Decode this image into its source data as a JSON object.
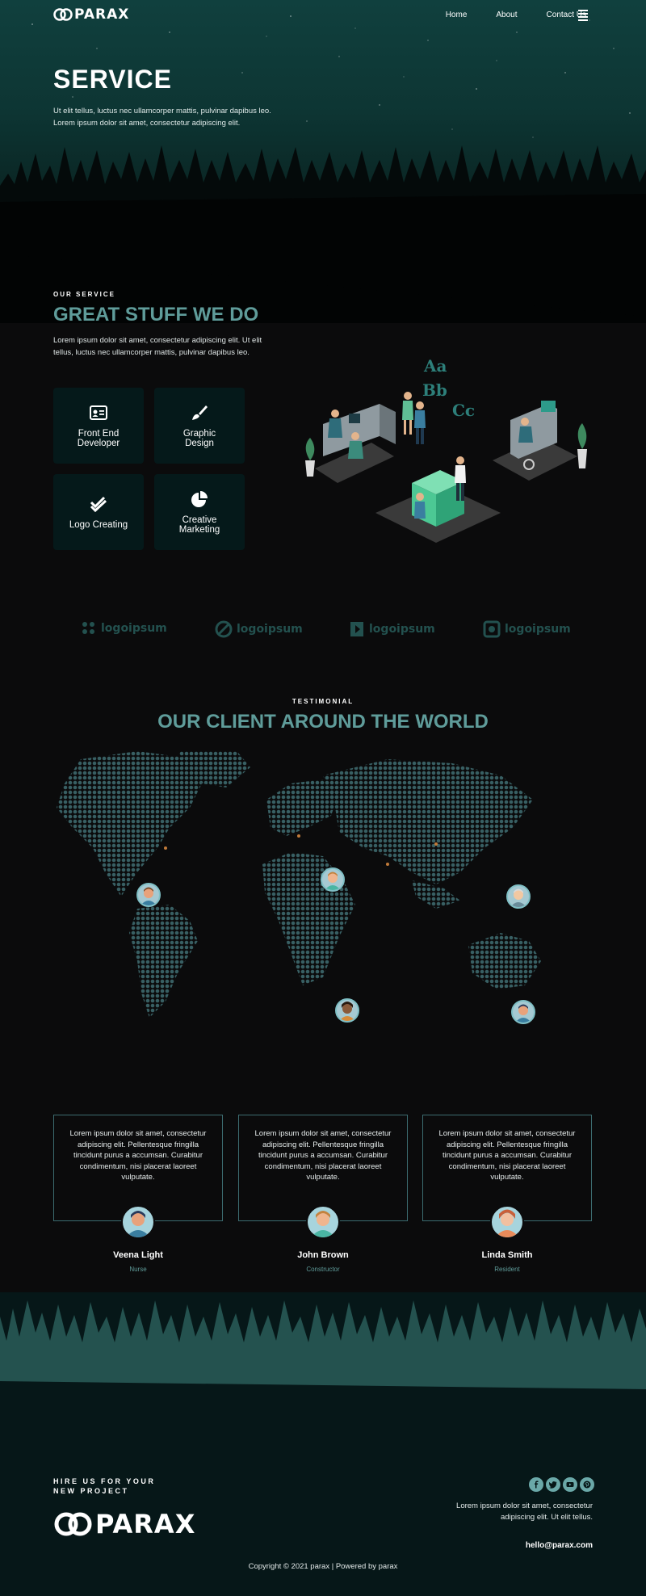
{
  "brand": {
    "name": "PARAX"
  },
  "nav": {
    "home": "Home",
    "about": "About",
    "contact": "Contact Us"
  },
  "hero": {
    "title": "SERVICE",
    "subtitle_line1": "Ut elit tellus, luctus nec ullamcorper mattis, pulvinar dapibus leo.",
    "subtitle_line2": "Lorem ipsum dolor sit amet, consectetur adipiscing elit."
  },
  "service": {
    "eyebrow": "OUR SERVICE",
    "title": "GREAT STUFF WE DO",
    "text": "Lorem ipsum dolor sit amet, consectetur adipiscing elit. Ut elit tellus, luctus nec ullamcorper mattis, pulvinar dapibus leo.",
    "cards": [
      {
        "line1": "Front End",
        "line2": "Developer",
        "icon": "id-card-icon"
      },
      {
        "line1": "Graphic",
        "line2": "Design",
        "icon": "paint-brush-icon"
      },
      {
        "line1": "Logo Creating",
        "line2": "",
        "icon": "double-check-icon"
      },
      {
        "line1": "Creative",
        "line2": "Marketing",
        "icon": "pie-chart-icon"
      }
    ],
    "illustration_letters": [
      "Aa",
      "Bb",
      "Cc"
    ]
  },
  "partners": [
    "logoipsum",
    "logoipsum",
    "logoipsum",
    "logoipsum"
  ],
  "testimonial": {
    "eyebrow": "TESTIMONIAL",
    "title": "OUR CLIENT AROUND THE WORLD",
    "items": [
      {
        "text": "Lorem ipsum dolor sit amet, consectetur adipiscing elit. Pellentesque fringilla tincidunt purus a accumsan. Curabitur condimentum, nisi placerat laoreet vulputate.",
        "name": "Veena Light",
        "role": "Nurse"
      },
      {
        "text": "Lorem ipsum dolor sit amet, consectetur adipiscing elit. Pellentesque fringilla tincidunt purus a accumsan. Curabitur condimentum, nisi placerat laoreet vulputate.",
        "name": "John Brown",
        "role": "Constructor"
      },
      {
        "text": "Lorem ipsum dolor sit amet, consectetur adipiscing elit. Pellentesque fringilla tincidunt purus a accumsan. Curabitur condimentum, nisi placerat laoreet vulputate.",
        "name": "Linda Smith",
        "role": "Resident"
      }
    ]
  },
  "footer": {
    "eyebrow_line1": "HIRE US FOR YOUR",
    "eyebrow_line2": "NEW PROJECT",
    "description": "Lorem ipsum dolor sit amet, consectetur adipiscing elit. Ut elit tellus.",
    "email": "hello@parax.com",
    "copyright": "Copyright © 2021 parax | Powered by parax",
    "social": [
      "facebook-icon",
      "twitter-icon",
      "youtube-icon",
      "pinterest-icon"
    ]
  },
  "colors": {
    "accent": "#5f9c9a",
    "card_bg": "#05191a",
    "hero_bg": "#0d3533",
    "page_bg": "#0b0b0c"
  }
}
